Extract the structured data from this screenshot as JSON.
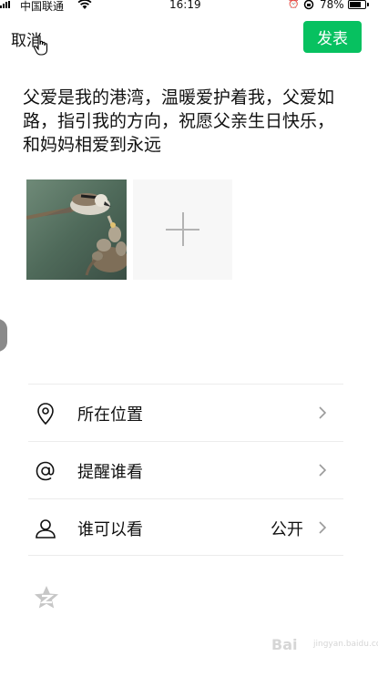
{
  "status_bar": {
    "carrier": "中国联通",
    "time": "16:19",
    "battery": "78%",
    "battery_level": 0.78,
    "icons": [
      "signal-icon",
      "wifi-icon",
      "alarm-icon",
      "orientation-lock-icon",
      "battery-icon"
    ]
  },
  "header": {
    "cancel_label": "取消",
    "publish_label": "发表"
  },
  "post": {
    "text": "父爱是我的港湾，温暖爱护着我，父爱如路，指引我的方向，祝愿父亲生日快乐，和妈妈相爱到永远"
  },
  "images": {
    "photo_icon": "bird-feeding-chicks-photo",
    "add_icon": "plus-icon"
  },
  "options": [
    {
      "icon": "location-pin-icon",
      "label": "所在位置",
      "value": ""
    },
    {
      "icon": "at-sign-icon",
      "label": "提醒谁看",
      "value": ""
    },
    {
      "icon": "person-icon",
      "label": "谁可以看",
      "value": "公开"
    }
  ],
  "watermark": {
    "text": "Bai",
    "sub": "jingyan.baidu.com"
  },
  "colors": {
    "accent": "#07c160",
    "divider": "#ececec",
    "add_tile": "#f7f7f7"
  }
}
